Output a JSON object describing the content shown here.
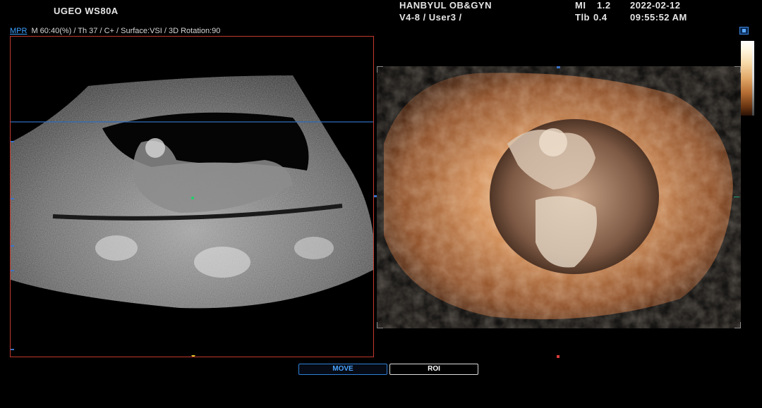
{
  "header": {
    "model": "UGEO WS80A",
    "institution": "HANBYUL OB&GYN",
    "probe": "V4-8 / User3 /",
    "mi_label": "MI",
    "mi_value": "1.2",
    "tib_label": "Tlb",
    "tib_value": "0.4",
    "date": "2022-02-12",
    "time": "09:55:52 AM"
  },
  "mode_bar": {
    "mode": "MPR",
    "params": "M 60:40(%) / Th 37 / C+ / Surface:VSI / 3D Rotation:90"
  },
  "buttons": {
    "move": "MOVE",
    "roi": "ROI"
  },
  "colors": {
    "accent_blue": "#3aa0ff",
    "frame_red": "#c0392b",
    "render_orange": "#d98a4a"
  },
  "icons": [
    "settings-icon",
    "colorbar"
  ]
}
